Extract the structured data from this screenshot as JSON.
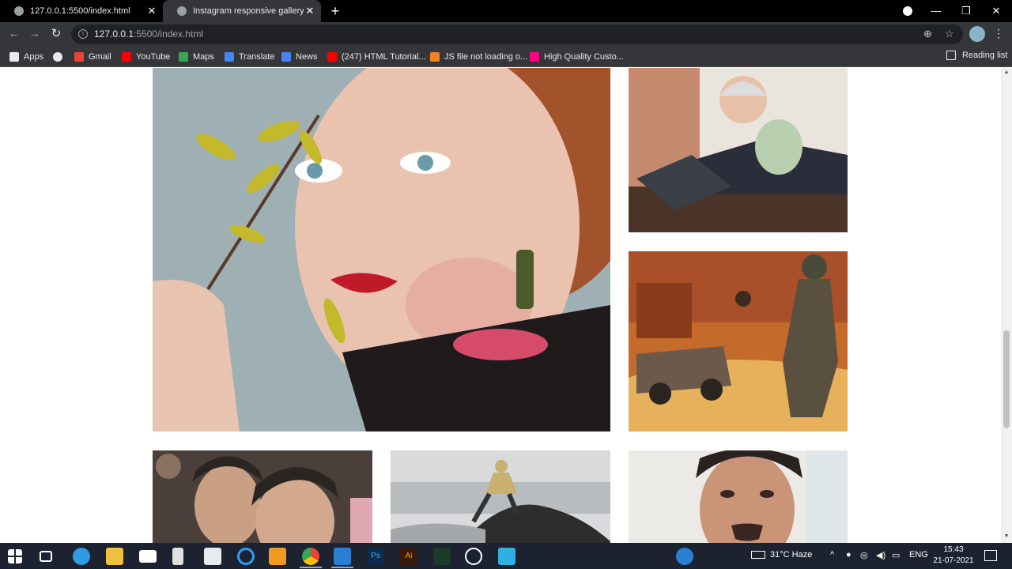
{
  "browser": {
    "tabs": [
      {
        "title": "127.0.0.1:5500/index.html",
        "active": false
      },
      {
        "title": "Instagram responsive gallery",
        "active": true
      }
    ],
    "new_tab_symbol": "+",
    "close_symbol": "✕",
    "address": {
      "host": "127.0.0.1",
      "rest": ":5500/index.html"
    },
    "bookmarks": [
      {
        "label": "Apps",
        "icon": "apps-grid-icon",
        "color": "#e8eaed"
      },
      {
        "label": "",
        "icon": "globe-icon",
        "color": "#e8eaed"
      },
      {
        "label": "Gmail",
        "icon": "gmail-icon",
        "color": "#ea4335"
      },
      {
        "label": "YouTube",
        "icon": "youtube-icon",
        "color": "#ff0000"
      },
      {
        "label": "Maps",
        "icon": "maps-icon",
        "color": "#34a853"
      },
      {
        "label": "Translate",
        "icon": "translate-icon",
        "color": "#4285f4"
      },
      {
        "label": "News",
        "icon": "news-icon",
        "color": "#4285f4"
      },
      {
        "label": "(247) HTML Tutorial...",
        "icon": "youtube-icon",
        "color": "#ff0000"
      },
      {
        "label": "JS file not loading o...",
        "icon": "stackoverflow-icon",
        "color": "#f48024"
      },
      {
        "label": "High Quality Custo...",
        "icon": "flickr-icon",
        "color": "#ff0084"
      }
    ],
    "reading_list": "Reading list"
  },
  "gallery": {
    "images": [
      {
        "name": "woman-portrait-photo",
        "colors": [
          "#9fb0b4",
          "#e9c2b0",
          "#a3532c"
        ]
      },
      {
        "name": "businessman-cash-photo",
        "colors": [
          "#c58a6e",
          "#2a2d3a",
          "#e9e5dd"
        ]
      },
      {
        "name": "soldier-illustration-photo",
        "colors": [
          "#c46a2a",
          "#8a3b1c",
          "#e7b05a"
        ]
      },
      {
        "name": "friends-selfie-photo",
        "colors": [
          "#4a3f3a",
          "#c9a084",
          "#2b2522"
        ]
      },
      {
        "name": "climber-rock-photo",
        "colors": [
          "#d8dadc",
          "#a4a8ab",
          "#2d2d2d"
        ]
      },
      {
        "name": "man-portrait-photo",
        "colors": [
          "#eceae6",
          "#c99478",
          "#2a2220"
        ]
      }
    ]
  },
  "taskbar": {
    "weather": "31°C  Haze",
    "language": "ENG",
    "time": "15:43",
    "date": "21-07-2021"
  }
}
